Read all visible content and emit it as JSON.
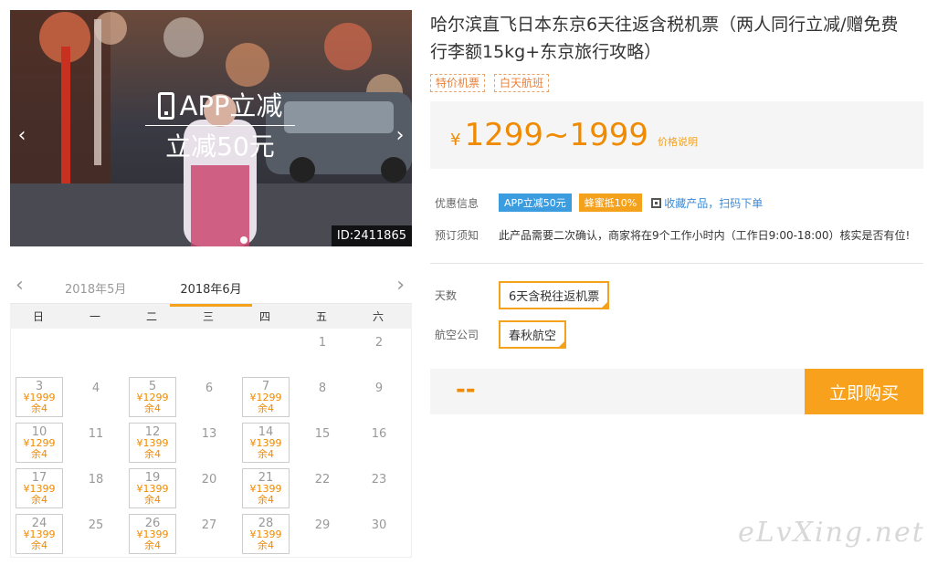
{
  "banner": {
    "promo_line1": "APP立减",
    "promo_line2": "立减50元",
    "id_label": "ID:2411865",
    "icons": {
      "prev": "chevron-left-icon",
      "next": "chevron-right-icon",
      "phone": "phone-icon"
    }
  },
  "calendar": {
    "prev_month": "2018年5月",
    "current_month": "2018年6月",
    "weekdays": [
      "日",
      "一",
      "二",
      "三",
      "四",
      "五",
      "六"
    ],
    "days": [
      {
        "d": ""
      },
      {
        "d": ""
      },
      {
        "d": ""
      },
      {
        "d": ""
      },
      {
        "d": ""
      },
      {
        "d": "1"
      },
      {
        "d": "2"
      },
      {
        "d": "3",
        "p": "¥1999",
        "s": "余4"
      },
      {
        "d": "4"
      },
      {
        "d": "5",
        "p": "¥1299",
        "s": "余4"
      },
      {
        "d": "6"
      },
      {
        "d": "7",
        "p": "¥1299",
        "s": "余4"
      },
      {
        "d": "8"
      },
      {
        "d": "9"
      },
      {
        "d": "10",
        "p": "¥1299",
        "s": "余4"
      },
      {
        "d": "11"
      },
      {
        "d": "12",
        "p": "¥1399",
        "s": "余4"
      },
      {
        "d": "13"
      },
      {
        "d": "14",
        "p": "¥1399",
        "s": "余4"
      },
      {
        "d": "15"
      },
      {
        "d": "16"
      },
      {
        "d": "17",
        "p": "¥1399",
        "s": "余4"
      },
      {
        "d": "18"
      },
      {
        "d": "19",
        "p": "¥1399",
        "s": "余4"
      },
      {
        "d": "20"
      },
      {
        "d": "21",
        "p": "¥1399",
        "s": "余4"
      },
      {
        "d": "22"
      },
      {
        "d": "23"
      },
      {
        "d": "24",
        "p": "¥1399",
        "s": "余4"
      },
      {
        "d": "25"
      },
      {
        "d": "26",
        "p": "¥1399",
        "s": "余4"
      },
      {
        "d": "27"
      },
      {
        "d": "28",
        "p": "¥1399",
        "s": "余4"
      },
      {
        "d": "29"
      },
      {
        "d": "30"
      }
    ]
  },
  "product": {
    "title": "哈尔滨直飞日本东京6天往返含税机票（两人同行立减/赠免费行李额15kg+东京旅行攻略）",
    "tags": [
      "特价机票",
      "白天航班"
    ],
    "price_currency": "¥",
    "price_value": "1299~1999",
    "price_note": "价格说明",
    "offer_label": "优惠信息",
    "offer_badge_app": "APP立减50元",
    "offer_badge_honey": "蜂蜜抵10%",
    "qr_text": "收藏产品，扫码下单",
    "notice_label": "预订须知",
    "notice_text": "此产品需要二次确认，商家将在9个工作小时内（工作日9:00-18:00）核实是否有位!",
    "days_label": "天数",
    "days_option": "6天含税往返机票",
    "airline_label": "航空公司",
    "airline_option": "春秋航空",
    "total": "--",
    "buy_label": "立即购买"
  },
  "watermark": "eLvXing.net",
  "colors": {
    "accent": "#f4a11c",
    "price": "#f08a00",
    "blue": "#3b9ce0"
  }
}
